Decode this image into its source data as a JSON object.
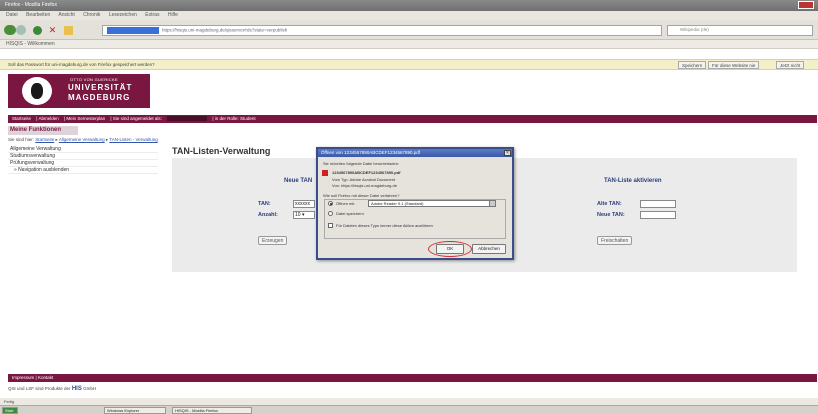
{
  "browser": {
    "window_title": "Firefox - Mozilla Firefox",
    "menu": [
      "Datei",
      "Bearbeiten",
      "Ansicht",
      "Chronik",
      "Lesezeichen",
      "Extras",
      "Hilfe"
    ],
    "url": "https://hisqis.uni-magdeburg.de/qisserver/rds?state=verpublish",
    "search_placeholder": "Wikipedia (de)",
    "bookmarks": [
      "HISQIS - Willkommen"
    ],
    "notification": "Soll das Passwort für uni-magdeburg.de von Firefox gespeichert werden?",
    "notification_buttons": [
      "Speichern",
      "Für diese Website nie",
      "Jetzt nicht"
    ],
    "status": "Fertig"
  },
  "logo": {
    "small": "OTTO VON GUERICKE",
    "line1": "UNIVERSITÄT",
    "line2": "MAGDEBURG"
  },
  "topnav": [
    "Startseite",
    "Abmelden",
    "Mein Semesterplan",
    "Sie sind angemeldet als:",
    "in der Rolle: Student"
  ],
  "functions_title": "Meine Funktionen",
  "breadcrumb": {
    "prefix": "Sie sind hier:",
    "items": [
      "Startseite",
      "Allgemeine Verwaltung",
      "TAN-Listen - Verwaltung"
    ]
  },
  "sidebar": [
    "Allgemeine Verwaltung",
    "Studiumsverwaltung",
    "Prüfungsverwaltung",
    "Navigation ausblenden"
  ],
  "content": {
    "title": "TAN-Listen-Verwaltung",
    "neue_heading": "Neue TAN",
    "tan_label": "TAN:",
    "tan_value": "xxxxxx",
    "anzahl_label": "Anzahl:",
    "anzahl_value": "10",
    "erzeugen_button": "Erzeugen",
    "aktiv_heading": "TAN-Liste aktivieren",
    "alte_tan_label": "Alte TAN:",
    "neue_tan_label": "Neue TAN:",
    "freischalten_button": "Freischalten"
  },
  "dialog": {
    "title": "Öffnen von  1234567890ABCDEF1234567890.pdf",
    "intro": "Sie möchten folgende Datei herunterladen:",
    "filename": "1234567890ABCDEF1234567890.pdf",
    "type_line": "Vom Typ:  Adobe Acrobat Document",
    "from_line": "Von:  https://hisqis.uni-magdeburg.de",
    "question": "Wie soll Firefox mit dieser Datei verfahren?",
    "open_with_label": "Öffnen mit",
    "app_value": "Adobe Reader 9.1 (Standard)",
    "save_label": "Datei speichern",
    "remember_label": "Für Dateien dieses Typs immer diese Aktion ausführen",
    "ok_button": "OK",
    "cancel_button": "Abbrechen"
  },
  "footer": {
    "links": [
      "Impressum",
      "Kontakt"
    ],
    "text_prefix": "QIS und LSF sind Produkte der",
    "his": "HIS",
    "text_suffix": "GmbH"
  },
  "taskbar": [
    "Start",
    "Windows Explorer",
    "HISQIS - Mozilla Firefox"
  ],
  "colors": {
    "brand": "#7a1740",
    "dialog_title": "#3a5aa8",
    "highlight": "#d03030"
  }
}
